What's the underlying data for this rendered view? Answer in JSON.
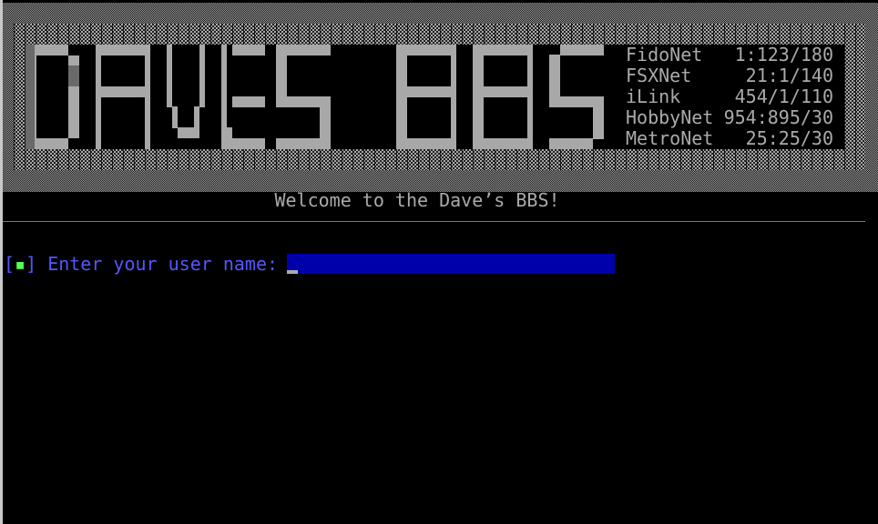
{
  "header": {
    "logo_text": "DAVES BBS",
    "networks": [
      {
        "name": "FidoNet",
        "address": "1:123/180"
      },
      {
        "name": "FSXNet",
        "address": "21:1/140"
      },
      {
        "name": "iLink",
        "address": "454/1/110"
      },
      {
        "name": "HobbyNet",
        "address": "954:895/30"
      },
      {
        "name": "MetroNet",
        "address": "25:25/30"
      }
    ]
  },
  "welcome": "Welcome to the Dave’s BBS!",
  "login": {
    "bracket_open": "[",
    "bullet": "▪",
    "bracket_close": "]",
    "prompt": "Enter your user name:",
    "value": ""
  },
  "colors": {
    "prompt": "#5555ff",
    "input_bg": "#0000aa",
    "text": "#aaaaaa",
    "bullet": "#55ff55"
  }
}
